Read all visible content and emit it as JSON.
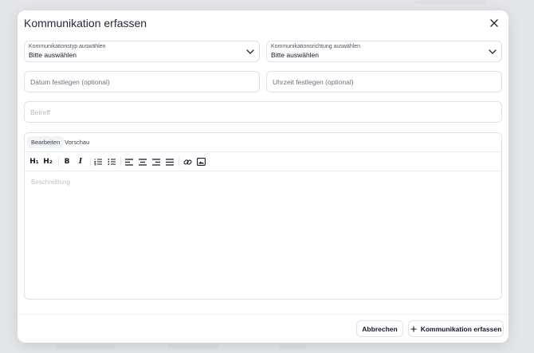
{
  "modal": {
    "title": "Kommunikation erfassen",
    "type_select": {
      "label": "Kommunikationstyp auswählen",
      "value": "Bitte auswählen"
    },
    "direction_select": {
      "label": "Kommunikationsrichtung auswählen",
      "value": "Bitte auswählen"
    },
    "date_field": {
      "placeholder": "Datum festlegen (optional)"
    },
    "time_field": {
      "placeholder": "Uhrzeit festlegen (optional)"
    },
    "subject_field": {
      "placeholder": "Betreff"
    },
    "editor": {
      "tabs": [
        "Bearbeiten",
        "Vorschau"
      ],
      "active_tab": "Bearbeiten",
      "toolbar": {
        "h1": "H₁",
        "h2": "H₂",
        "bold": "B",
        "italic": "I"
      },
      "description_placeholder": "Beschreibung"
    },
    "cancel_label": "Abbrechen",
    "submit_label": "Kommunikation erfassen"
  },
  "colors": {
    "accent_text": "#111827",
    "border": "#dfe2e6",
    "background": "#e6e8eb"
  },
  "icons": [
    "close-icon",
    "chevron-down-icon",
    "ordered-list-icon",
    "bullet-list-icon",
    "align-left-icon",
    "align-center-icon",
    "align-right-icon",
    "align-justify-icon",
    "link-icon",
    "image-icon",
    "plus-icon"
  ]
}
